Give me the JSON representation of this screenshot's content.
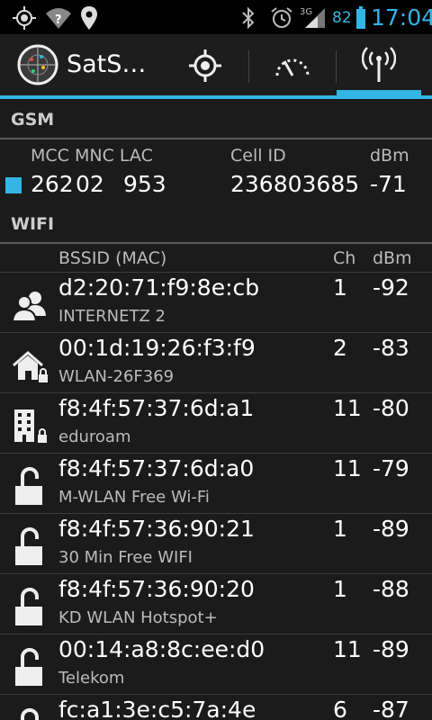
{
  "status_bar": {
    "icons": [
      "gps-icon",
      "wifi-question-icon",
      "location-pin-icon",
      "bluetooth-icon",
      "alarm-icon",
      "signal-3g-icon",
      "battery-icon"
    ],
    "network_type": "3G",
    "battery_percent": "82",
    "time": "17:04",
    "accent_color": "#33b5e5"
  },
  "action_bar": {
    "title": "SatS…",
    "tabs": [
      {
        "name": "gps-tab",
        "icon": "crosshair-icon"
      },
      {
        "name": "gauge-tab",
        "icon": "gauge-icon"
      },
      {
        "name": "radio-tab",
        "icon": "antenna-icon",
        "selected": true
      }
    ]
  },
  "gsm": {
    "section_title": "GSM",
    "headers": {
      "mcc_mnc_lac": "MCC MNC LAC",
      "cell_id": "Cell ID",
      "dbm": "dBm"
    },
    "mcc": "262",
    "mnc": "02",
    "lac": "953",
    "cell_id": "236803685",
    "dbm": "-71"
  },
  "wifi": {
    "section_title": "WIFI",
    "headers": {
      "bssid": "BSSID (MAC)",
      "ch": "Ch",
      "dbm": "dBm"
    },
    "networks": [
      {
        "bssid": "d2:20:71:f9:8e:cb",
        "ssid": "INTERNETZ 2",
        "ch": "1",
        "dbm": "-92",
        "icon": "adhoc-users-icon"
      },
      {
        "bssid": "00:1d:19:26:f3:f9",
        "ssid": "WLAN-26F369",
        "ch": "2",
        "dbm": "-83",
        "icon": "home-lock-icon"
      },
      {
        "bssid": "f8:4f:57:37:6d:a1",
        "ssid": "eduroam",
        "ch": "11",
        "dbm": "-80",
        "icon": "building-lock-icon"
      },
      {
        "bssid": "f8:4f:57:37:6d:a0",
        "ssid": "M-WLAN Free Wi-Fi",
        "ch": "11",
        "dbm": "-79",
        "icon": "open-lock-icon"
      },
      {
        "bssid": "f8:4f:57:36:90:21",
        "ssid": "30 Min Free WIFI",
        "ch": "1",
        "dbm": "-89",
        "icon": "open-lock-icon"
      },
      {
        "bssid": "f8:4f:57:36:90:20",
        "ssid": "KD WLAN Hotspot+",
        "ch": "1",
        "dbm": "-88",
        "icon": "open-lock-icon"
      },
      {
        "bssid": "00:14:a8:8c:ee:d0",
        "ssid": "Telekom",
        "ch": "11",
        "dbm": "-89",
        "icon": "open-lock-icon"
      },
      {
        "bssid": "fc:a1:3e:c5:7a:4e",
        "ssid": "",
        "ch": "6",
        "dbm": "-87",
        "icon": "open-lock-icon"
      }
    ]
  }
}
